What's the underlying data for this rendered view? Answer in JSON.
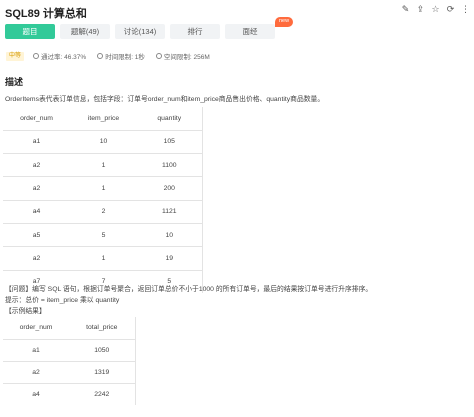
{
  "header": {
    "title": "SQL89  计算总和",
    "icons": [
      "edit-icon",
      "share-icon",
      "star-icon",
      "sync-icon",
      "more-icon"
    ]
  },
  "tabs": [
    {
      "label": "题目",
      "active": true
    },
    {
      "label": "题解(49)",
      "active": false
    },
    {
      "label": "讨论(134)",
      "active": false
    },
    {
      "label": "排行",
      "active": false
    },
    {
      "label": "面经",
      "active": false
    }
  ],
  "new_badge": "new",
  "meta": {
    "level": "中等",
    "pass_rate": "通过率: 46.37%",
    "time_limit": "时间限制: 1秒",
    "space_limit": "空间限制: 256M"
  },
  "section_title": "描述",
  "description": "OrderItems表代表订单信息，包括字段：订单号order_num和item_price商品售出价格、quantity商品数量。",
  "orders_table": {
    "headers": [
      "order_num",
      "item_price",
      "quantity"
    ],
    "rows": [
      [
        "a1",
        "10",
        "105"
      ],
      [
        "a2",
        "1",
        "1100"
      ],
      [
        "a2",
        "1",
        "200"
      ],
      [
        "a4",
        "2",
        "1121"
      ],
      [
        "a5",
        "5",
        "10"
      ],
      [
        "a2",
        "1",
        "19"
      ],
      [
        "a7",
        "7",
        "5"
      ]
    ]
  },
  "question": "【问题】编写 SQL 语句，根据订单号聚合，返回订单总价不小于1000 的所有订单号，最后的结果按订单号进行升序排序。",
  "hint": "提示：总价 = item_price 乘以 quantity",
  "example_label": "【示例结果】",
  "result_table": {
    "headers": [
      "order_num",
      "total_price"
    ],
    "rows": [
      [
        "a1",
        "1050"
      ],
      [
        "a2",
        "1319"
      ],
      [
        "a4",
        "2242"
      ]
    ]
  }
}
